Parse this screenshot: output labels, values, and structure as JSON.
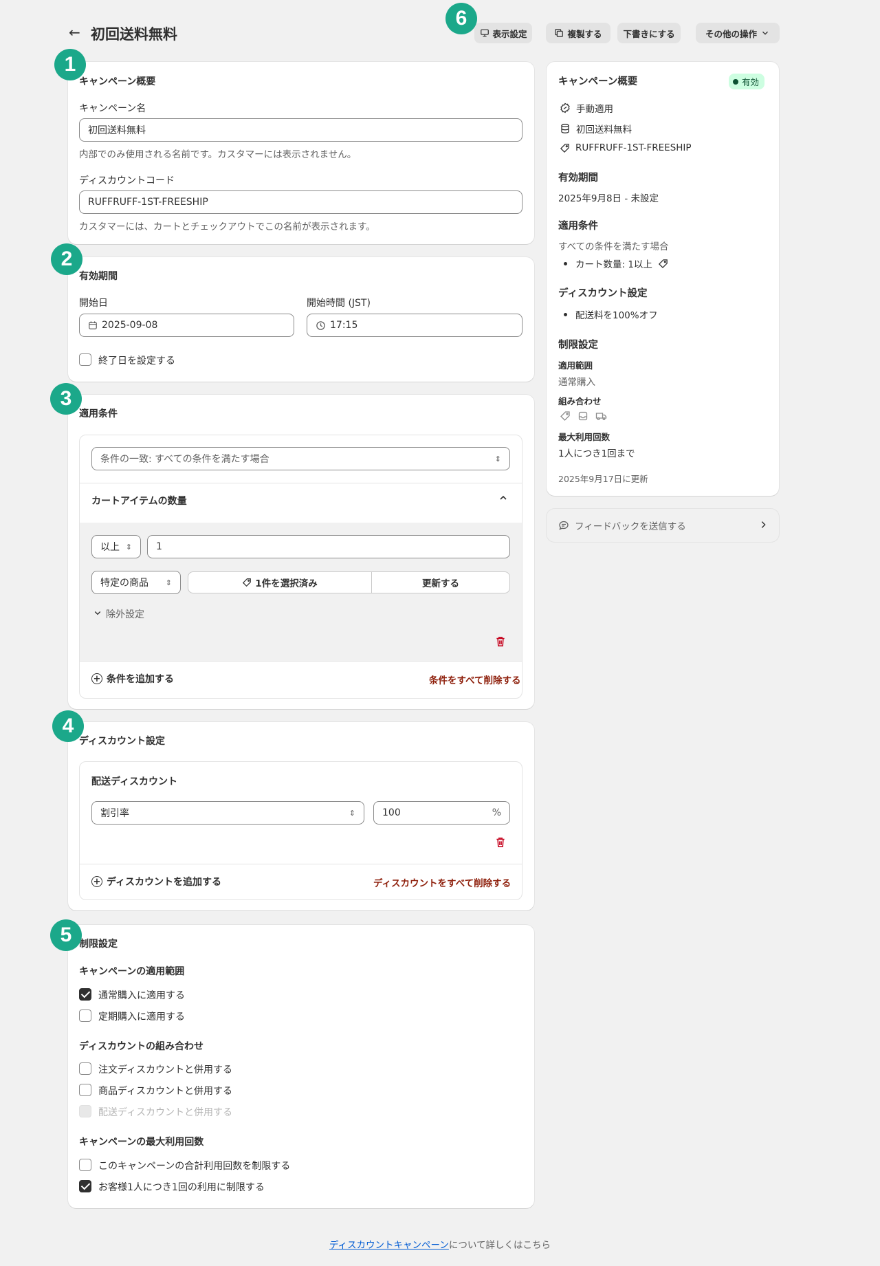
{
  "header": {
    "title": "初回送料無料",
    "buttons": {
      "display_settings": "表示設定",
      "duplicate": "複製する",
      "draft": "下書きにする",
      "more_actions": "その他の操作"
    }
  },
  "badges": [
    "1",
    "2",
    "3",
    "4",
    "5",
    "6"
  ],
  "overview": {
    "title": "キャンペーン概要",
    "name_label": "キャンペーン名",
    "name_value": "初回送料無料",
    "name_help": "内部でのみ使用される名前です。カスタマーには表示されません。",
    "code_label": "ディスカウントコード",
    "code_value": "RUFFRUFF-1ST-FREESHIP",
    "code_help": "カスタマーには、カートとチェックアウトでこの名前が表示されます。"
  },
  "period": {
    "title": "有効期間",
    "start_date_label": "開始日",
    "start_date_value": "2025-09-08",
    "start_time_label": "開始時間 (JST)",
    "start_time_value": "17:15",
    "end_date_checkbox": "終了日を設定する"
  },
  "conditions": {
    "title": "適用条件",
    "match_select": "条件の一致: すべての条件を満たす場合",
    "cart_section_title": "カートアイテムの数量",
    "operator_select": "以上",
    "quantity_value": "1",
    "product_select": "特定の商品",
    "selected_button": "1件を選択済み",
    "update_button": "更新する",
    "exclusion_toggle": "除外設定",
    "add_condition": "条件を追加する",
    "remove_all": "条件をすべて削除する"
  },
  "discount": {
    "title": "ディスカウント設定",
    "shipping_title": "配送ディスカウント",
    "type_select": "割引率",
    "value": "100",
    "unit": "%",
    "add_discount": "ディスカウントを追加する",
    "remove_all": "ディスカウントをすべて削除する"
  },
  "limits": {
    "title": "制限設定",
    "scope_title": "キャンペーンの適用範囲",
    "scope_options": [
      {
        "label": "通常購入に適用する",
        "checked": true
      },
      {
        "label": "定期購入に適用する",
        "checked": false
      }
    ],
    "combine_title": "ディスカウントの組み合わせ",
    "combine_options": [
      {
        "label": "注文ディスカウントと併用する",
        "checked": false
      },
      {
        "label": "商品ディスカウントと併用する",
        "checked": false
      },
      {
        "label": "配送ディスカウントと併用する",
        "checked": false,
        "disabled": true
      }
    ],
    "max_title": "キャンペーンの最大利用回数",
    "max_options": [
      {
        "label": "このキャンペーンの合計利用回数を制限する",
        "checked": false
      },
      {
        "label": "お客様1人につき1回の利用に制限する",
        "checked": true
      }
    ]
  },
  "summary": {
    "title": "キャンペーン概要",
    "status": "有効",
    "method": "手動適用",
    "name": "初回送料無料",
    "code": "RUFFRUFF-1ST-FREESHIP",
    "period_title": "有効期間",
    "period_value": "2025年9月8日 - 未設定",
    "conditions_title": "適用条件",
    "conditions_desc": "すべての条件を満たす場合",
    "conditions_item": "カート数量: 1以上",
    "discount_title": "ディスカウント設定",
    "discount_item": "配送料を100%オフ",
    "limits_title": "制限設定",
    "scope_label": "適用範囲",
    "scope_value": "通常購入",
    "combine_label": "組み合わせ",
    "max_label": "最大利用回数",
    "max_value": "1人につき1回まで",
    "updated": "2025年9月17日に更新"
  },
  "feedback": {
    "label": "フィードバックを送信する"
  },
  "footer": {
    "link": "ディスカウントキャンペーン",
    "suffix": "について詳しくはこちら"
  },
  "colors": {
    "badge": "#1ba88a",
    "danger": "#8e1f0b",
    "link": "#005bd3",
    "status_bg": "#cdfee1"
  }
}
